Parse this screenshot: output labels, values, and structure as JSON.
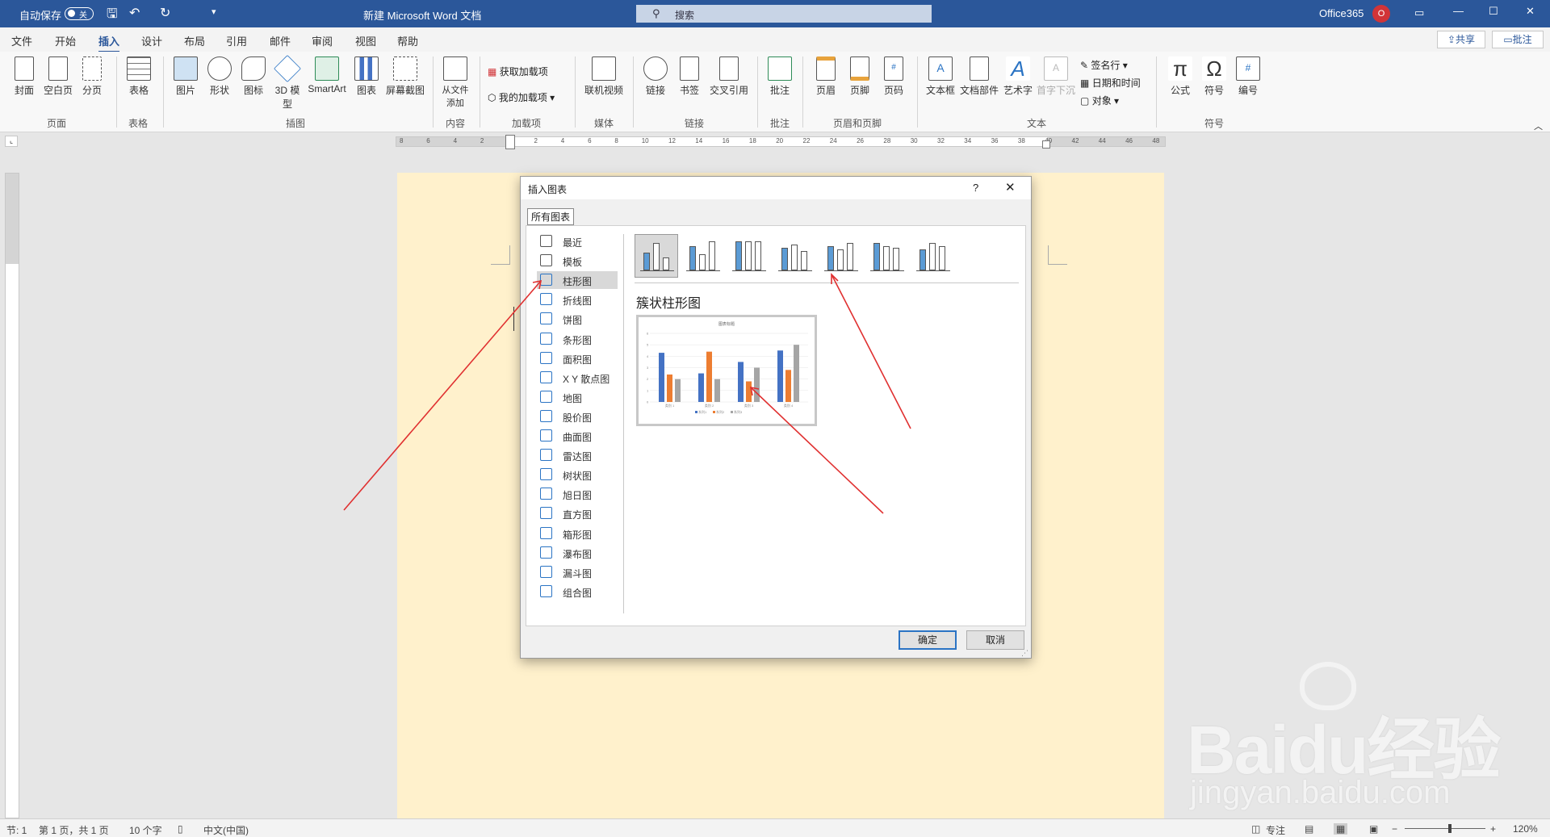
{
  "titlebar": {
    "autosave_label": "自动保存",
    "autosave_state": "关",
    "doc_title": "新建 Microsoft Word 文档",
    "search_placeholder": "搜索",
    "account": "Office365",
    "avatar_letter": "O"
  },
  "tabs": [
    "文件",
    "开始",
    "插入",
    "设计",
    "布局",
    "引用",
    "邮件",
    "审阅",
    "视图",
    "帮助"
  ],
  "active_tab": "插入",
  "share_button": "共享",
  "comment_button": "批注",
  "ribbon": {
    "buttons": {
      "cover": "封面",
      "blank": "空白页",
      "pagebreak": "分页",
      "table": "表格",
      "picture": "图片",
      "shapes": "形状",
      "icons": "图标",
      "model3d": "3D 模型",
      "smartart": "SmartArt",
      "chart": "图表",
      "screenshot": "屏幕截图",
      "fromfile": "从文件添加",
      "getaddins": "获取加载项",
      "myaddins": "我的加载项",
      "video": "联机视频",
      "link": "链接",
      "bookmark": "书签",
      "crossref": "交叉引用",
      "comment": "批注",
      "header": "页眉",
      "footer": "页脚",
      "pagenum": "页码",
      "textbox": "文本框",
      "quickparts": "文档部件",
      "wordart": "艺术字",
      "dropcap": "首字下沉",
      "signature": "签名行",
      "datetime": "日期和时间",
      "object": "对象",
      "equation": "公式",
      "symbol": "符号",
      "number": "编号"
    },
    "groups": {
      "pages": "页面",
      "tables": "表格",
      "illustrations": "插图",
      "content": "内容",
      "addins": "加载项",
      "media": "媒体",
      "links": "链接",
      "comments": "批注",
      "headerfooter": "页眉和页脚",
      "text": "文本",
      "symbols": "符号"
    }
  },
  "hruler_labels": [
    "8",
    "6",
    "4",
    "2",
    "",
    "2",
    "4",
    "6",
    "8",
    "10",
    "12",
    "14",
    "16",
    "18",
    "20",
    "22",
    "24",
    "26",
    "28",
    "30",
    "32",
    "34",
    "36",
    "38",
    "40",
    "42",
    "44",
    "46",
    "48"
  ],
  "dialog": {
    "title": "插入图表",
    "help": "?",
    "tab": "所有图表",
    "categories": [
      "最近",
      "模板",
      "柱形图",
      "折线图",
      "饼图",
      "条形图",
      "面积图",
      "X Y 散点图",
      "地图",
      "股价图",
      "曲面图",
      "雷达图",
      "树状图",
      "旭日图",
      "直方图",
      "箱形图",
      "瀑布图",
      "漏斗图",
      "组合图"
    ],
    "selected_category": "柱形图",
    "subtype_title": "簇状柱形图",
    "preview_title": "图表标题",
    "ok": "确定",
    "cancel": "取消"
  },
  "preview_chart": {
    "chart_data": {
      "type": "bar",
      "title": "图表标题",
      "categories": [
        "类别 1",
        "类别 2",
        "类别 3",
        "类别 4"
      ],
      "series": [
        {
          "name": "系列1",
          "values": [
            4.3,
            2.5,
            3.5,
            4.5
          ],
          "color": "#4472c4"
        },
        {
          "name": "系列2",
          "values": [
            2.4,
            4.4,
            1.8,
            2.8
          ],
          "color": "#ed7d31"
        },
        {
          "name": "系列3",
          "values": [
            2.0,
            2.0,
            3.0,
            5.0
          ],
          "color": "#a5a5a5"
        }
      ],
      "ylim": [
        0,
        6
      ],
      "yticks": [
        "0",
        "1",
        "2",
        "3",
        "4",
        "5",
        "6"
      ]
    }
  },
  "status": {
    "section": "节: 1",
    "page": "第 1 页，共 1 页",
    "words": "10 个字",
    "lang": "中文(中国)",
    "focus": "专注",
    "zoom": "120%"
  },
  "watermark": {
    "brand": "Baidu经验",
    "url": "jingyan.baidu.com"
  },
  "colors": {
    "word_blue": "#2b579a",
    "page_bg": "#fff1cc",
    "arrow_red": "#e03030"
  }
}
